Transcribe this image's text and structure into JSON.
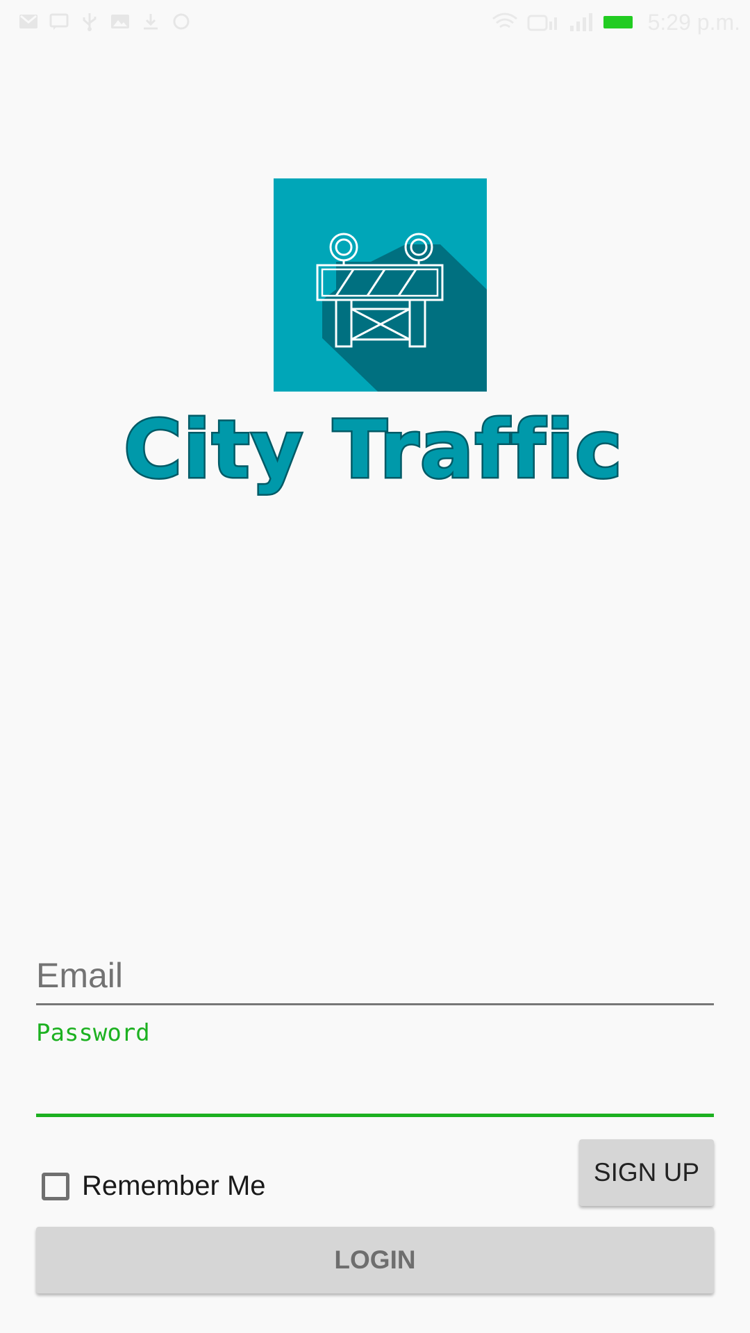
{
  "status_bar": {
    "time": "5:29 p.m.",
    "left_icons": [
      "gmail-icon",
      "message-icon",
      "usb-icon",
      "image-icon",
      "download-icon",
      "sync-icon"
    ],
    "right_icons": [
      "wifi-icon",
      "hd-icon",
      "signal-icon",
      "signal-icon",
      "battery-icon"
    ],
    "battery_color": "#22cc22"
  },
  "logo": {
    "wordmark": "City Traffic",
    "icon": "road-barrier-icon",
    "tile_color": "#00a6b8",
    "shadow_color": "#007080",
    "text_color": "#0099aa",
    "text_outline": "#005a66"
  },
  "form": {
    "email_placeholder": "Email",
    "email_value": "",
    "password_label": "Password",
    "password_value": "",
    "remember_label": "Remember Me",
    "remember_checked": false,
    "signup_label": "SIGN UP",
    "login_label": "LOGIN",
    "accent_color": "#1db121"
  }
}
